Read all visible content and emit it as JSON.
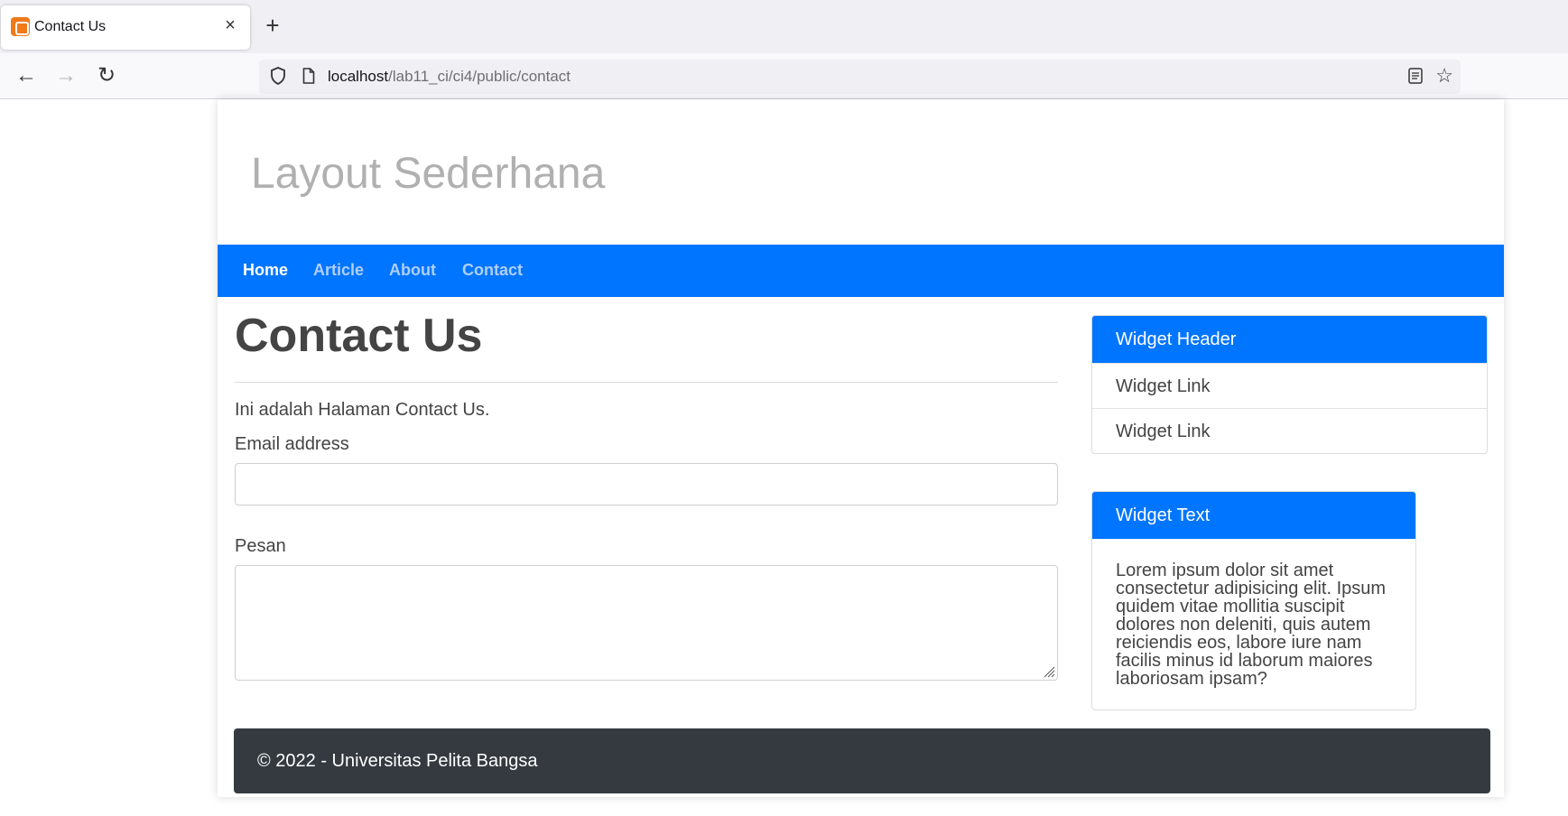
{
  "browser": {
    "tab_title": "Contact Us",
    "close_glyph": "×",
    "new_tab_glyph": "+",
    "back_glyph": "←",
    "forward_glyph": "→",
    "reload_glyph": "↻",
    "url_host": "localhost",
    "url_path": "/lab11_ci/ci4/public/contact",
    "star_glyph": "☆"
  },
  "site": {
    "title": "Layout Sederhana",
    "menu": [
      {
        "label": "Home",
        "active": true
      },
      {
        "label": "Article",
        "active": false
      },
      {
        "label": "About",
        "active": false
      },
      {
        "label": "Contact",
        "active": false
      }
    ]
  },
  "main": {
    "heading": "Contact Us",
    "intro": "Ini adalah Halaman Contact Us.",
    "email_label": "Email address",
    "email_value": "",
    "message_label": "Pesan",
    "message_value": ""
  },
  "sidebar": {
    "widget1": {
      "header": "Widget Header",
      "links": [
        "Widget Link",
        "Widget Link"
      ]
    },
    "widget2": {
      "header": "Widget Text",
      "body": "Lorem ipsum dolor sit amet consectetur adipisicing elit. Ipsum quidem vitae mollitia suscipit dolores non deleniti, quis autem reiciendis eos, labore iure nam facilis minus id laborum maiores laboriosam ipsam?"
    }
  },
  "footer": {
    "text": "© 2022 - Universitas Pelita Bangsa"
  },
  "colors": {
    "primary": "#0075ff",
    "footer_bg": "#343a40",
    "title_gray": "#b0b0b0"
  }
}
